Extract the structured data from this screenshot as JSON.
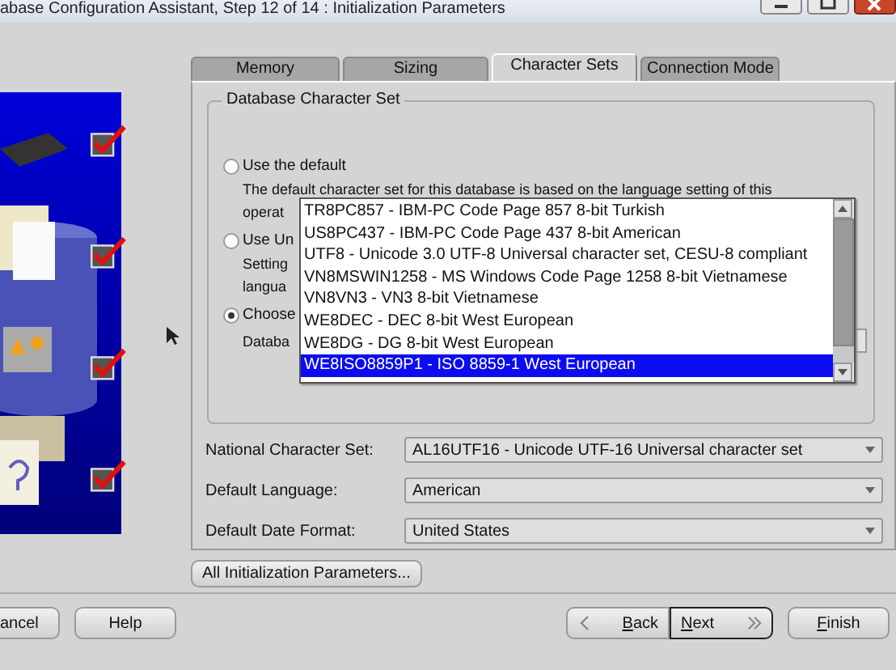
{
  "window": {
    "title": "abase Configuration Assistant, Step 12 of 14 : Initialization Parameters"
  },
  "steps": [
    {
      "checked": true
    },
    {
      "checked": true
    },
    {
      "checked": true
    },
    {
      "checked": true
    }
  ],
  "tabs": [
    {
      "label": "Memory",
      "selected": false
    },
    {
      "label": "Sizing",
      "selected": false
    },
    {
      "label": "Character Sets",
      "selected": true
    },
    {
      "label": "Connection Mode",
      "selected": false
    }
  ],
  "group": {
    "title": "Database Character Set",
    "options": [
      {
        "label": "Use the default",
        "selected": false,
        "lines": [
          "The default character set for this database is based on the language setting of this",
          "operat"
        ]
      },
      {
        "label": "Use Un",
        "selected": false,
        "lines": [
          "Setting",
          "langua"
        ]
      },
      {
        "label": "Choose",
        "selected": true,
        "lines": [
          "Databa"
        ]
      }
    ]
  },
  "charset_list": {
    "items": [
      {
        "label": "TR8PC857 - IBM-PC Code Page 857 8-bit Turkish",
        "selected": false
      },
      {
        "label": "US8PC437 - IBM-PC Code Page 437 8-bit American",
        "selected": false
      },
      {
        "label": "UTF8 - Unicode 3.0 UTF-8 Universal character set, CESU-8 compliant",
        "selected": false
      },
      {
        "label": "VN8MSWIN1258 - MS Windows Code Page 1258 8-bit Vietnamese",
        "selected": false
      },
      {
        "label": "VN8VN3 - VN3 8-bit Vietnamese",
        "selected": false
      },
      {
        "label": "WE8DEC - DEC 8-bit West European",
        "selected": false
      },
      {
        "label": "WE8DG - DG 8-bit West European",
        "selected": false
      },
      {
        "label": "WE8ISO8859P1 - ISO 8859-1 West European",
        "selected": true
      }
    ]
  },
  "fields": [
    {
      "label": "National Character Set:",
      "value": "AL16UTF16 - Unicode UTF-16 Universal character set"
    },
    {
      "label": "Default Language:",
      "value": "American"
    },
    {
      "label": "Default Date Format:",
      "value": "United States"
    }
  ],
  "all_params_button": "All Initialization Parameters...",
  "buttons": [
    {
      "label": "ancel",
      "kind": "plain",
      "first_letter_underlined": false,
      "default": false
    },
    {
      "label": "Help",
      "kind": "plain",
      "first_letter_underlined": false,
      "default": false
    },
    {
      "label": "Back",
      "kind": "back",
      "first_letter_underlined": true,
      "default": false
    },
    {
      "label": "Next",
      "kind": "next",
      "first_letter_underlined": true,
      "default": true
    },
    {
      "label": "Finish",
      "kind": "plain",
      "first_letter_underlined": true,
      "default": false
    }
  ]
}
